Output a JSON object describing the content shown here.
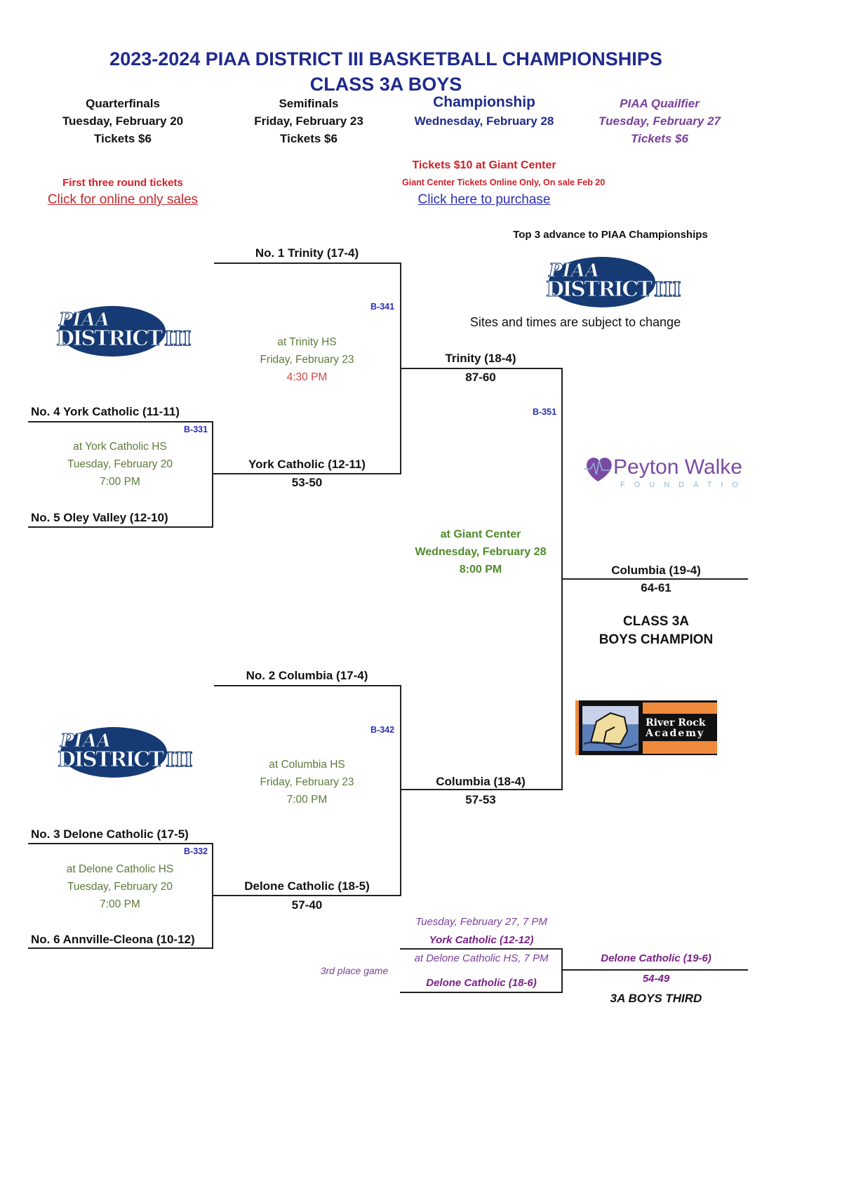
{
  "header": {
    "title_line1": "2023-2024 PIAA DISTRICT III BASKETBALL CHAMPIONSHIPS",
    "title_line2": "CLASS 3A BOYS"
  },
  "rounds": [
    {
      "name": "Quarterfinals",
      "date": "Tuesday, February 20",
      "tickets": "Tickets $6"
    },
    {
      "name": "Semifinals",
      "date": "Friday, February 23",
      "tickets": "Tickets $6"
    },
    {
      "name": "Championship",
      "date": "Wednesday, February 28",
      "tickets": ""
    },
    {
      "name": "PIAA Quailfier",
      "date": "Tuesday, February 27",
      "tickets": "Tickets $6"
    }
  ],
  "ticket_info": {
    "left_note": "First three round tickets",
    "left_link": "Click for online only sales",
    "champ_price": "Tickets $10 at Giant Center",
    "champ_note": "Giant Center Tickets Online Only, On sale Feb 20",
    "champ_link": "Click here to purchase"
  },
  "notes": {
    "advance": "Top 3 advance to PIAA Championships",
    "disclaimer": "Sites and times are subject to change"
  },
  "logos": {
    "piaa_top": "PIAA",
    "piaa_bottom": "DISTRICT",
    "piaa_roman": "III",
    "sponsor1_name": "Peyton Walker",
    "sponsor1_sub": "FOUNDATION",
    "sponsor2_line1": "River Rock",
    "sponsor2_line2": "Academy"
  },
  "quarterfinals": [
    {
      "code": "B-331",
      "team_top": "No. 4 York Catholic (11-11)",
      "team_bottom": "No. 5 Oley Valley (12-10)",
      "venue": "at York Catholic HS",
      "date": "Tuesday, February 20",
      "time": "7:00 PM"
    },
    {
      "code": "B-332",
      "team_top": "No. 3 Delone Catholic (17-5)",
      "team_bottom": "No. 6 Annville-Cleona (10-12)",
      "venue": "at Delone Catholic HS",
      "date": "Tuesday, February 20",
      "time": "7:00 PM"
    }
  ],
  "semifinals": [
    {
      "code": "B-341",
      "team_top": "No. 1 Trinity (17-4)",
      "team_bottom": "York Catholic (12-11)",
      "qf_score": "53-50",
      "venue": "at Trinity HS",
      "date": "Friday, February 23",
      "time": "4:30 PM"
    },
    {
      "code": "B-342",
      "team_top": "No. 2 Columbia (17-4)",
      "team_bottom": "Delone Catholic (18-5)",
      "qf_score": "57-40",
      "venue": "at Columbia HS",
      "date": "Friday, February 23",
      "time": "7:00 PM"
    }
  ],
  "championship": {
    "code": "B-351",
    "team_top": "Trinity (18-4)",
    "score_top": "87-60",
    "team_bottom": "Columbia (18-4)",
    "score_bottom": "57-53",
    "venue": "at Giant Center",
    "date": "Wednesday, February 28",
    "time": "8:00 PM",
    "winner": "Columbia (19-4)",
    "winner_score": "64-61",
    "winner_label1": "CLASS 3A",
    "winner_label2": "BOYS CHAMPION"
  },
  "third_place": {
    "label": "3rd place game",
    "datetime": "Tuesday, February 27, 7 PM",
    "team_top": "York Catholic (12-12)",
    "venue": "at Delone Catholic HS, 7 PM",
    "team_bottom": "Delone Catholic (18-6)",
    "winner": "Delone Catholic (19-6)",
    "winner_score": "54-49",
    "winner_label": "3A BOYS THIRD"
  },
  "colors": {
    "title_blue": "#1f2a8c",
    "code_blue": "#2b2fb5",
    "ticket_red": "#d0202a",
    "venue_green": "#5d7a3b",
    "qualifier_purple": "#7a3f9c",
    "third_place_purple": "#7a1f85"
  }
}
